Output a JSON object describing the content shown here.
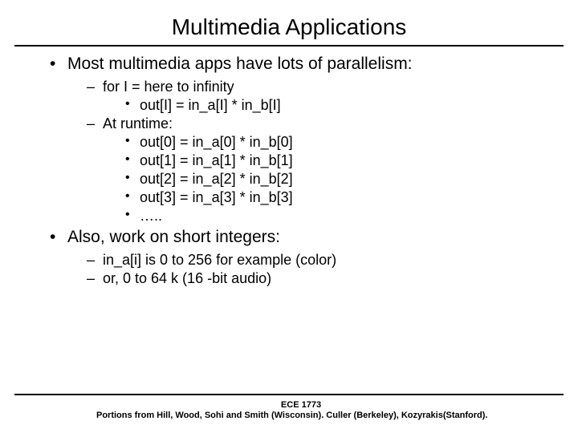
{
  "title": "Multimedia Applications",
  "bullets": {
    "b1": {
      "text": "Most multimedia apps have lots of parallelism:",
      "sub": {
        "s1": {
          "text": "for I = here to infinity",
          "sub": {
            "i1": "out[I] = in_a[I] * in_b[I]"
          }
        },
        "s2": {
          "text": "At runtime:",
          "sub": {
            "i1": "out[0] = in_a[0] * in_b[0]",
            "i2": "out[1] = in_a[1] * in_b[1]",
            "i3": "out[2] = in_a[2] * in_b[2]",
            "i4": "out[3] = in_a[3] * in_b[3]",
            "i5": "….."
          }
        }
      }
    },
    "b2": {
      "text": "Also, work on short integers:",
      "sub": {
        "s1": {
          "text": "in_a[i] is 0 to 256 for example (color)"
        },
        "s2": {
          "text": "or, 0 to 64 k (16 -bit audio)"
        }
      }
    }
  },
  "footer": {
    "course": "ECE 1773",
    "credits": "Portions from Hill, Wood, Sohi and Smith (Wisconsin). Culler (Berkeley), Kozyrakis(Stanford)."
  }
}
